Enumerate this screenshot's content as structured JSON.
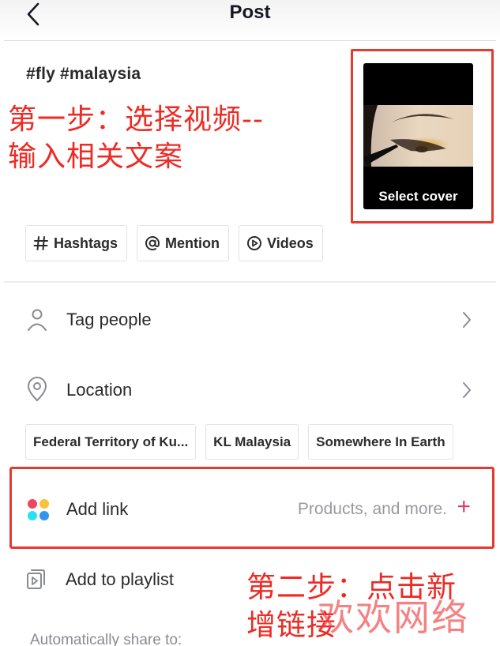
{
  "header": {
    "title": "Post",
    "back_icon": "chevron-left-icon"
  },
  "caption": {
    "text": "#fly #malaysia"
  },
  "annotations": {
    "step1_line1": "第一步：选择视频--",
    "step1_line2": "输入相关文案",
    "step2_line1": "第二步：点击新",
    "step2_line2": "增链接",
    "watermark": "欢欢网络",
    "highlight_color": "#e53a30"
  },
  "cover": {
    "label": "Select cover",
    "image": "eye-makeup-thumbnail"
  },
  "chips": [
    {
      "icon": "hash-icon",
      "label": "Hashtags"
    },
    {
      "icon": "at-icon",
      "label": "Mention"
    },
    {
      "icon": "play-circle-icon",
      "label": "Videos"
    }
  ],
  "rows": {
    "tag_people": {
      "icon": "person-icon",
      "label": "Tag people"
    },
    "location": {
      "icon": "location-pin-icon",
      "label": "Location"
    }
  },
  "location_suggestions": [
    "Federal Territory of Ku...",
    "KL Malaysia",
    "Somewhere In Earth"
  ],
  "add_link": {
    "label": "Add link",
    "hint": "Products, and more.",
    "plus": "+",
    "dot_colors": [
      "#f0445f",
      "#fbbf3b",
      "#27e3f1",
      "#2f95f0"
    ],
    "accent": "#e8385c"
  },
  "playlist": {
    "icon": "playlist-icon",
    "label": "Add to playlist"
  },
  "auto_share": {
    "label": "Automatically share to:"
  }
}
